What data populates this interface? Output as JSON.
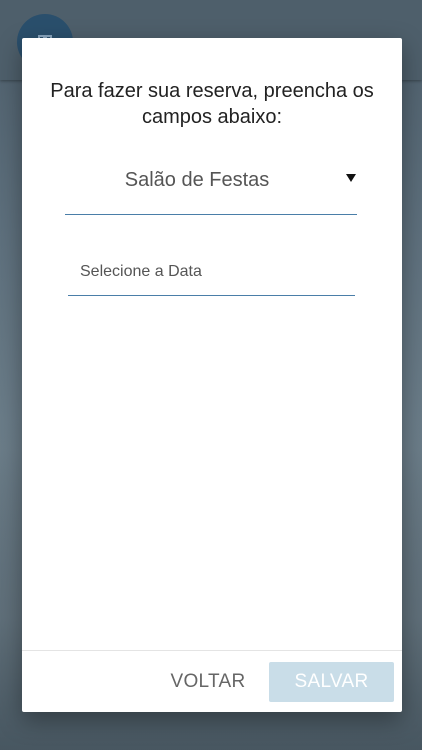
{
  "background": {
    "avatar_icon": "building-icon",
    "appbar_color": "#4e5f6b",
    "avatar_color": "#2a4f6c"
  },
  "dialog": {
    "title": "Para fazer sua reserva, preencha os campos abaixo:",
    "area_select": {
      "selected_value": "Salão de Festas",
      "icon": "triangle-down-icon"
    },
    "date_field": {
      "placeholder": "Selecione a Data"
    },
    "actions": {
      "back_label": "VOLTAR",
      "save_label": "SALVAR",
      "save_enabled": false
    },
    "colors": {
      "underline": "#4a7ea8",
      "save_disabled_bg": "#c9dde8"
    }
  }
}
